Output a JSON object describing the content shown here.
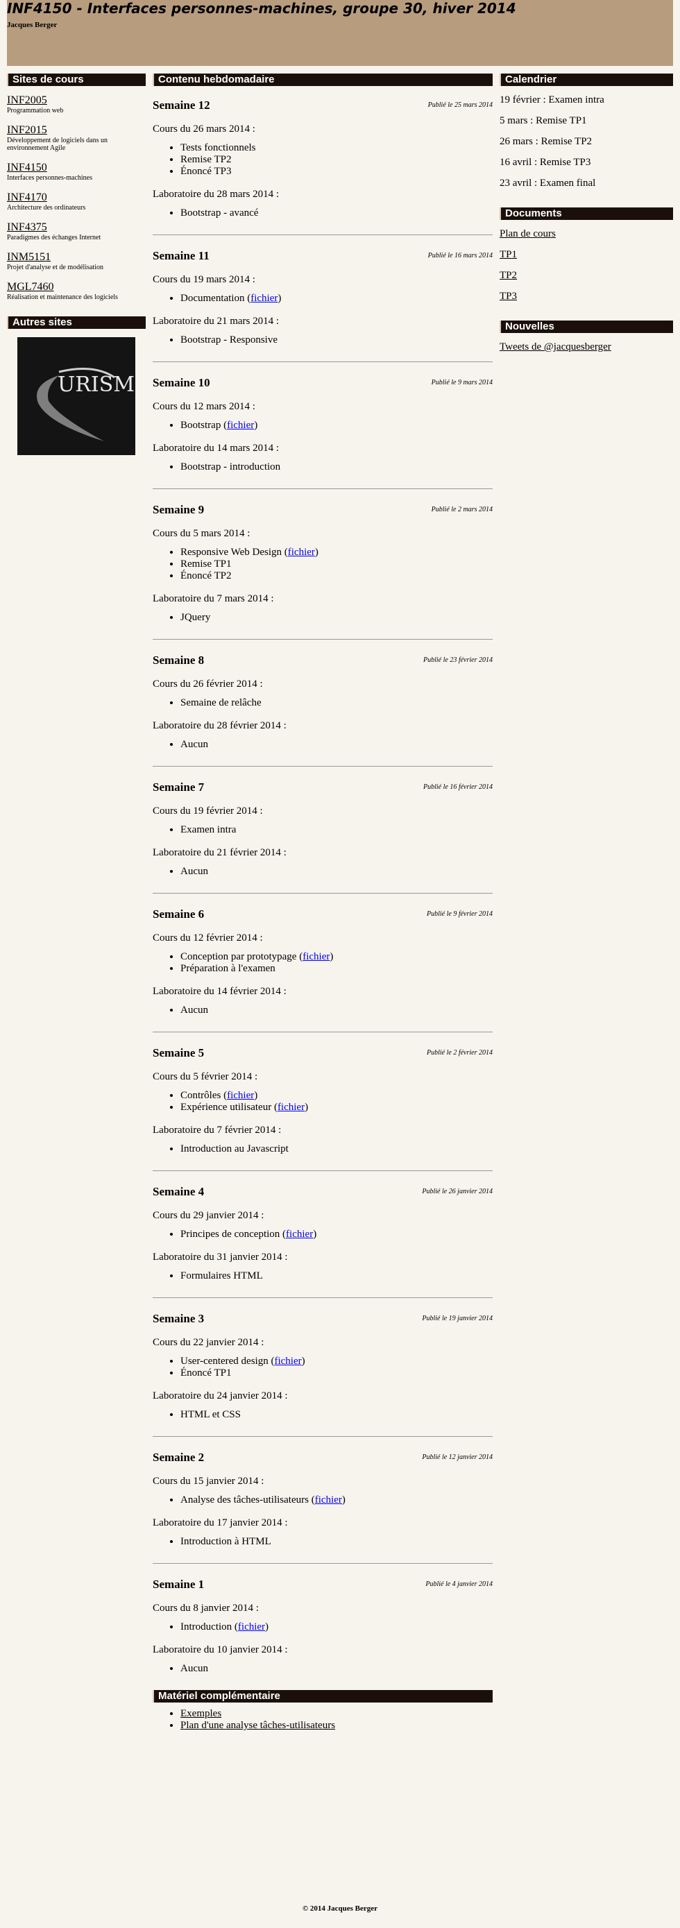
{
  "header": {
    "title": "INF4150 - Interfaces personnes-machines, groupe 30, hiver 2014",
    "author": "Jacques Berger"
  },
  "left": {
    "sites_title": "Sites de cours",
    "sites": [
      {
        "code": "INF2005",
        "desc": "Programmation web"
      },
      {
        "code": "INF2015",
        "desc": "Développement de logiciels dans un environnement Agile"
      },
      {
        "code": "INF4150",
        "desc": "Interfaces personnes-machines"
      },
      {
        "code": "INF4170",
        "desc": "Architecture des ordinateurs"
      },
      {
        "code": "INF4375",
        "desc": "Paradigmes des échanges Internet"
      },
      {
        "code": "INM5151",
        "desc": "Projet d'analyse et de modélisation"
      },
      {
        "code": "MGL7460",
        "desc": "Réalisation et maintenance des logiciels"
      }
    ],
    "other_title": "Autres sites",
    "logo_text": "URISM"
  },
  "main": {
    "title": "Contenu hebdomadaire",
    "weeks": [
      {
        "title": "Semaine 12",
        "posted": "Publié le 25 mars 2014",
        "course": "Cours du 26 mars 2014 :",
        "course_items": [
          {
            "text": "Tests fonctionnels"
          },
          {
            "text": "Remise TP2"
          },
          {
            "text": "Énoncé TP3"
          }
        ],
        "lab": "Laboratoire du 28 mars 2014 :",
        "lab_items": [
          {
            "text": "Bootstrap - avancé"
          }
        ]
      },
      {
        "title": "Semaine 11",
        "posted": "Publié le 16 mars 2014",
        "course": "Cours du 19 mars 2014 :",
        "course_items": [
          {
            "text": "Documentation (",
            "link": "fichier",
            "after": ")"
          }
        ],
        "lab": "Laboratoire du 21 mars 2014 :",
        "lab_items": [
          {
            "text": "Bootstrap - Responsive"
          }
        ]
      },
      {
        "title": "Semaine 10",
        "posted": "Publié le 9 mars 2014",
        "course": "Cours du 12 mars 2014 :",
        "course_items": [
          {
            "text": "Bootstrap (",
            "link": "fichier",
            "after": ")"
          }
        ],
        "lab": "Laboratoire du 14 mars 2014 :",
        "lab_items": [
          {
            "text": "Bootstrap - introduction"
          }
        ]
      },
      {
        "title": "Semaine 9",
        "posted": "Publié le 2 mars 2014",
        "course": "Cours du 5 mars 2014 :",
        "course_items": [
          {
            "text": "Responsive Web Design (",
            "link": "fichier",
            "after": ")"
          },
          {
            "text": "Remise TP1"
          },
          {
            "text": "Énoncé TP2"
          }
        ],
        "lab": "Laboratoire du 7 mars 2014 :",
        "lab_items": [
          {
            "text": "JQuery"
          }
        ]
      },
      {
        "title": "Semaine 8",
        "posted": "Publié le 23 février 2014",
        "course": "Cours du 26 février 2014 :",
        "course_items": [
          {
            "text": "Semaine de relâche"
          }
        ],
        "lab": "Laboratoire du 28 février 2014 :",
        "lab_items": [
          {
            "text": "Aucun"
          }
        ]
      },
      {
        "title": "Semaine 7",
        "posted": "Publié le 16 février 2014",
        "course": "Cours du 19 février 2014 :",
        "course_items": [
          {
            "text": "Examen intra"
          }
        ],
        "lab": "Laboratoire du 21 février 2014 :",
        "lab_items": [
          {
            "text": "Aucun"
          }
        ]
      },
      {
        "title": "Semaine 6",
        "posted": "Publié le 9 février 2014",
        "course": "Cours du 12 février 2014 :",
        "course_items": [
          {
            "text": "Conception par prototypage (",
            "link": "fichier",
            "after": ")"
          },
          {
            "text": "Préparation à l'examen"
          }
        ],
        "lab": "Laboratoire du 14 février 2014 :",
        "lab_items": [
          {
            "text": "Aucun"
          }
        ]
      },
      {
        "title": "Semaine 5",
        "posted": "Publié le 2 février 2014",
        "course": "Cours du 5 février 2014 :",
        "course_items": [
          {
            "text": "Contrôles (",
            "link": "fichier",
            "after": ")"
          },
          {
            "text": "Expérience utilisateur (",
            "link": "fichier",
            "after": ")"
          }
        ],
        "lab": "Laboratoire du 7 février 2014 :",
        "lab_items": [
          {
            "text": "Introduction au Javascript"
          }
        ]
      },
      {
        "title": "Semaine 4",
        "posted": "Publié le 26 janvier 2014",
        "course": "Cours du 29 janvier 2014 :",
        "course_items": [
          {
            "text": "Principes de conception (",
            "link": "fichier",
            "after": ")"
          }
        ],
        "lab": "Laboratoire du 31 janvier 2014 :",
        "lab_items": [
          {
            "text": "Formulaires HTML"
          }
        ]
      },
      {
        "title": "Semaine 3",
        "posted": "Publié le 19 janvier 2014",
        "course": "Cours du 22 janvier 2014 :",
        "course_items": [
          {
            "text": "User-centered design (",
            "link": "fichier",
            "after": ")"
          },
          {
            "text": "Énoncé TP1"
          }
        ],
        "lab": "Laboratoire du 24 janvier 2014 :",
        "lab_items": [
          {
            "text": "HTML et CSS"
          }
        ]
      },
      {
        "title": "Semaine 2",
        "posted": "Publié le 12 janvier 2014",
        "course": "Cours du 15 janvier 2014 :",
        "course_items": [
          {
            "text": "Analyse des tâches-utilisateurs (",
            "link": "fichier",
            "after": ")"
          }
        ],
        "lab": "Laboratoire du 17 janvier 2014 :",
        "lab_items": [
          {
            "text": "Introduction à HTML"
          }
        ]
      },
      {
        "title": "Semaine 1",
        "posted": "Publié le 4 janvier 2014",
        "course": "Cours du 8 janvier 2014 :",
        "course_items": [
          {
            "text": "Introduction (",
            "link": "fichier",
            "after": ")"
          }
        ],
        "lab": "Laboratoire du 10 janvier 2014 :",
        "lab_items": [
          {
            "text": "Aucun"
          }
        ]
      }
    ],
    "extra_title": "Matériel complémentaire",
    "extra_items": [
      "Exemples",
      "Plan d'une analyse tâches-utilisateurs"
    ]
  },
  "right": {
    "calendar_title": "Calendrier",
    "calendar": [
      "19 février : Examen intra",
      "5 mars : Remise TP1",
      "26 mars : Remise TP2",
      "16 avril : Remise TP3",
      "23 avril : Examen final"
    ],
    "documents_title": "Documents",
    "documents": [
      "Plan de cours",
      "TP1",
      "TP2",
      "TP3"
    ],
    "news_title": "Nouvelles",
    "news_link": "Tweets de @jacquesberger"
  },
  "footer": "© 2014 Jacques Berger"
}
